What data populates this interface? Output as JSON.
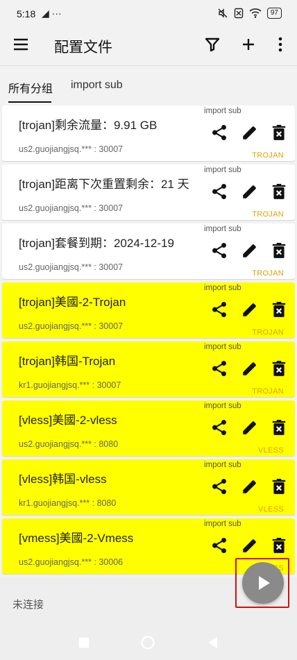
{
  "status_bar": {
    "time": "5:18",
    "left_icons": "◢ ···",
    "battery": "97"
  },
  "app_bar": {
    "title": "配置文件"
  },
  "tabs": [
    {
      "label": "所有分组"
    },
    {
      "label": "import sub"
    }
  ],
  "profiles": [
    {
      "name": "[trojan]剩余流量：9.91 GB",
      "server": "us2.guojiangjsq.*** : 30007",
      "subscription": "import sub",
      "type": "TROJAN",
      "highlighted": false
    },
    {
      "name": "[trojan]距离下次重置剩余：21 天",
      "server": "us2.guojiangjsq.*** : 30007",
      "subscription": "import sub",
      "type": "TROJAN",
      "highlighted": false
    },
    {
      "name": "[trojan]套餐到期：2024-12-19",
      "server": "us2.guojiangjsq.*** : 30007",
      "subscription": "import sub",
      "type": "TROJAN",
      "highlighted": false
    },
    {
      "name": "[trojan]美國-2-Trojan",
      "server": "us2.guojiangjsq.*** : 30007",
      "subscription": "import sub",
      "type": "TROJAN",
      "highlighted": true
    },
    {
      "name": "[trojan]韩国-Trojan",
      "server": "kr1.guojiangjsq.*** : 30007",
      "subscription": "import sub",
      "type": "TROJAN",
      "highlighted": true
    },
    {
      "name": "[vless]美國-2-vless",
      "server": "us2.guojiangjsq.*** : 8080",
      "subscription": "import sub",
      "type": "VLESS",
      "highlighted": true
    },
    {
      "name": "[vless]韩国-vless",
      "server": "kr1.guojiangjsq.*** : 8080",
      "subscription": "import sub",
      "type": "VLESS",
      "highlighted": true
    },
    {
      "name": "[vmess]美國-2-Vmess",
      "server": "us2.guojiangjsq.*** : 30006",
      "subscription": "import sub",
      "type": "VMESS",
      "highlighted": true
    }
  ],
  "bottom": {
    "connection_status": "未连接"
  },
  "colors": {
    "highlight": "#ffff00",
    "type_label": "#e0a000",
    "fab": "#8a8a8a",
    "annotation_box": "#d01010"
  }
}
